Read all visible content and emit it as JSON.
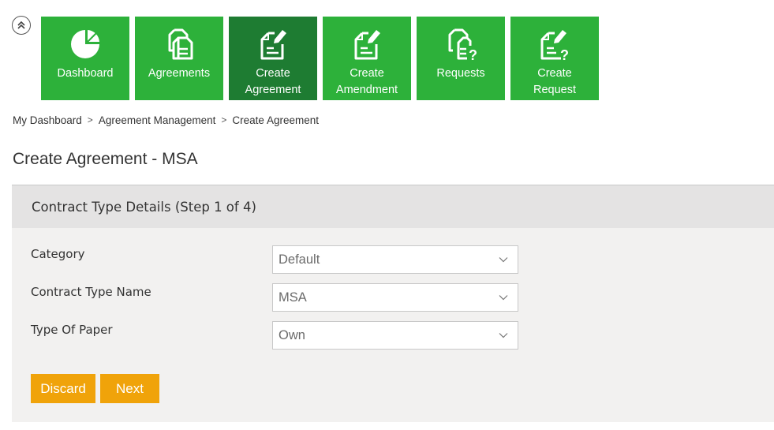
{
  "nav": {
    "collapse_icon": "double-chevron-up-icon",
    "tiles": [
      {
        "label_line1": "Dashboard",
        "label_line2": "",
        "icon": "pie-chart-icon",
        "active": false
      },
      {
        "label_line1": "Agreements",
        "label_line2": "",
        "icon": "documents-icon",
        "active": false
      },
      {
        "label_line1": "Create",
        "label_line2": "Agreement",
        "icon": "document-edit-icon",
        "active": true
      },
      {
        "label_line1": "Create",
        "label_line2": "Amendment",
        "icon": "document-edit-icon",
        "active": false
      },
      {
        "label_line1": "Requests",
        "label_line2": "",
        "icon": "documents-question-icon",
        "active": false
      },
      {
        "label_line1": "Create",
        "label_line2": "Request",
        "icon": "document-edit-question-icon",
        "active": false
      }
    ],
    "colors": {
      "tile": "#2db13a",
      "tile_active": "#1e7c32"
    }
  },
  "breadcrumb": {
    "items": [
      "My Dashboard",
      "Agreement Management",
      "Create Agreement"
    ],
    "separator": ">"
  },
  "page": {
    "title": "Create Agreement - MSA"
  },
  "panel": {
    "header": "Contract Type Details (Step 1 of 4)",
    "fields": [
      {
        "label": "Category",
        "value": "Default"
      },
      {
        "label": "Contract Type Name",
        "value": "MSA"
      },
      {
        "label": "Type Of Paper",
        "value": "Own"
      }
    ],
    "buttons": {
      "discard": "Discard",
      "next": "Next"
    },
    "colors": {
      "button": "#f0a30a"
    }
  }
}
